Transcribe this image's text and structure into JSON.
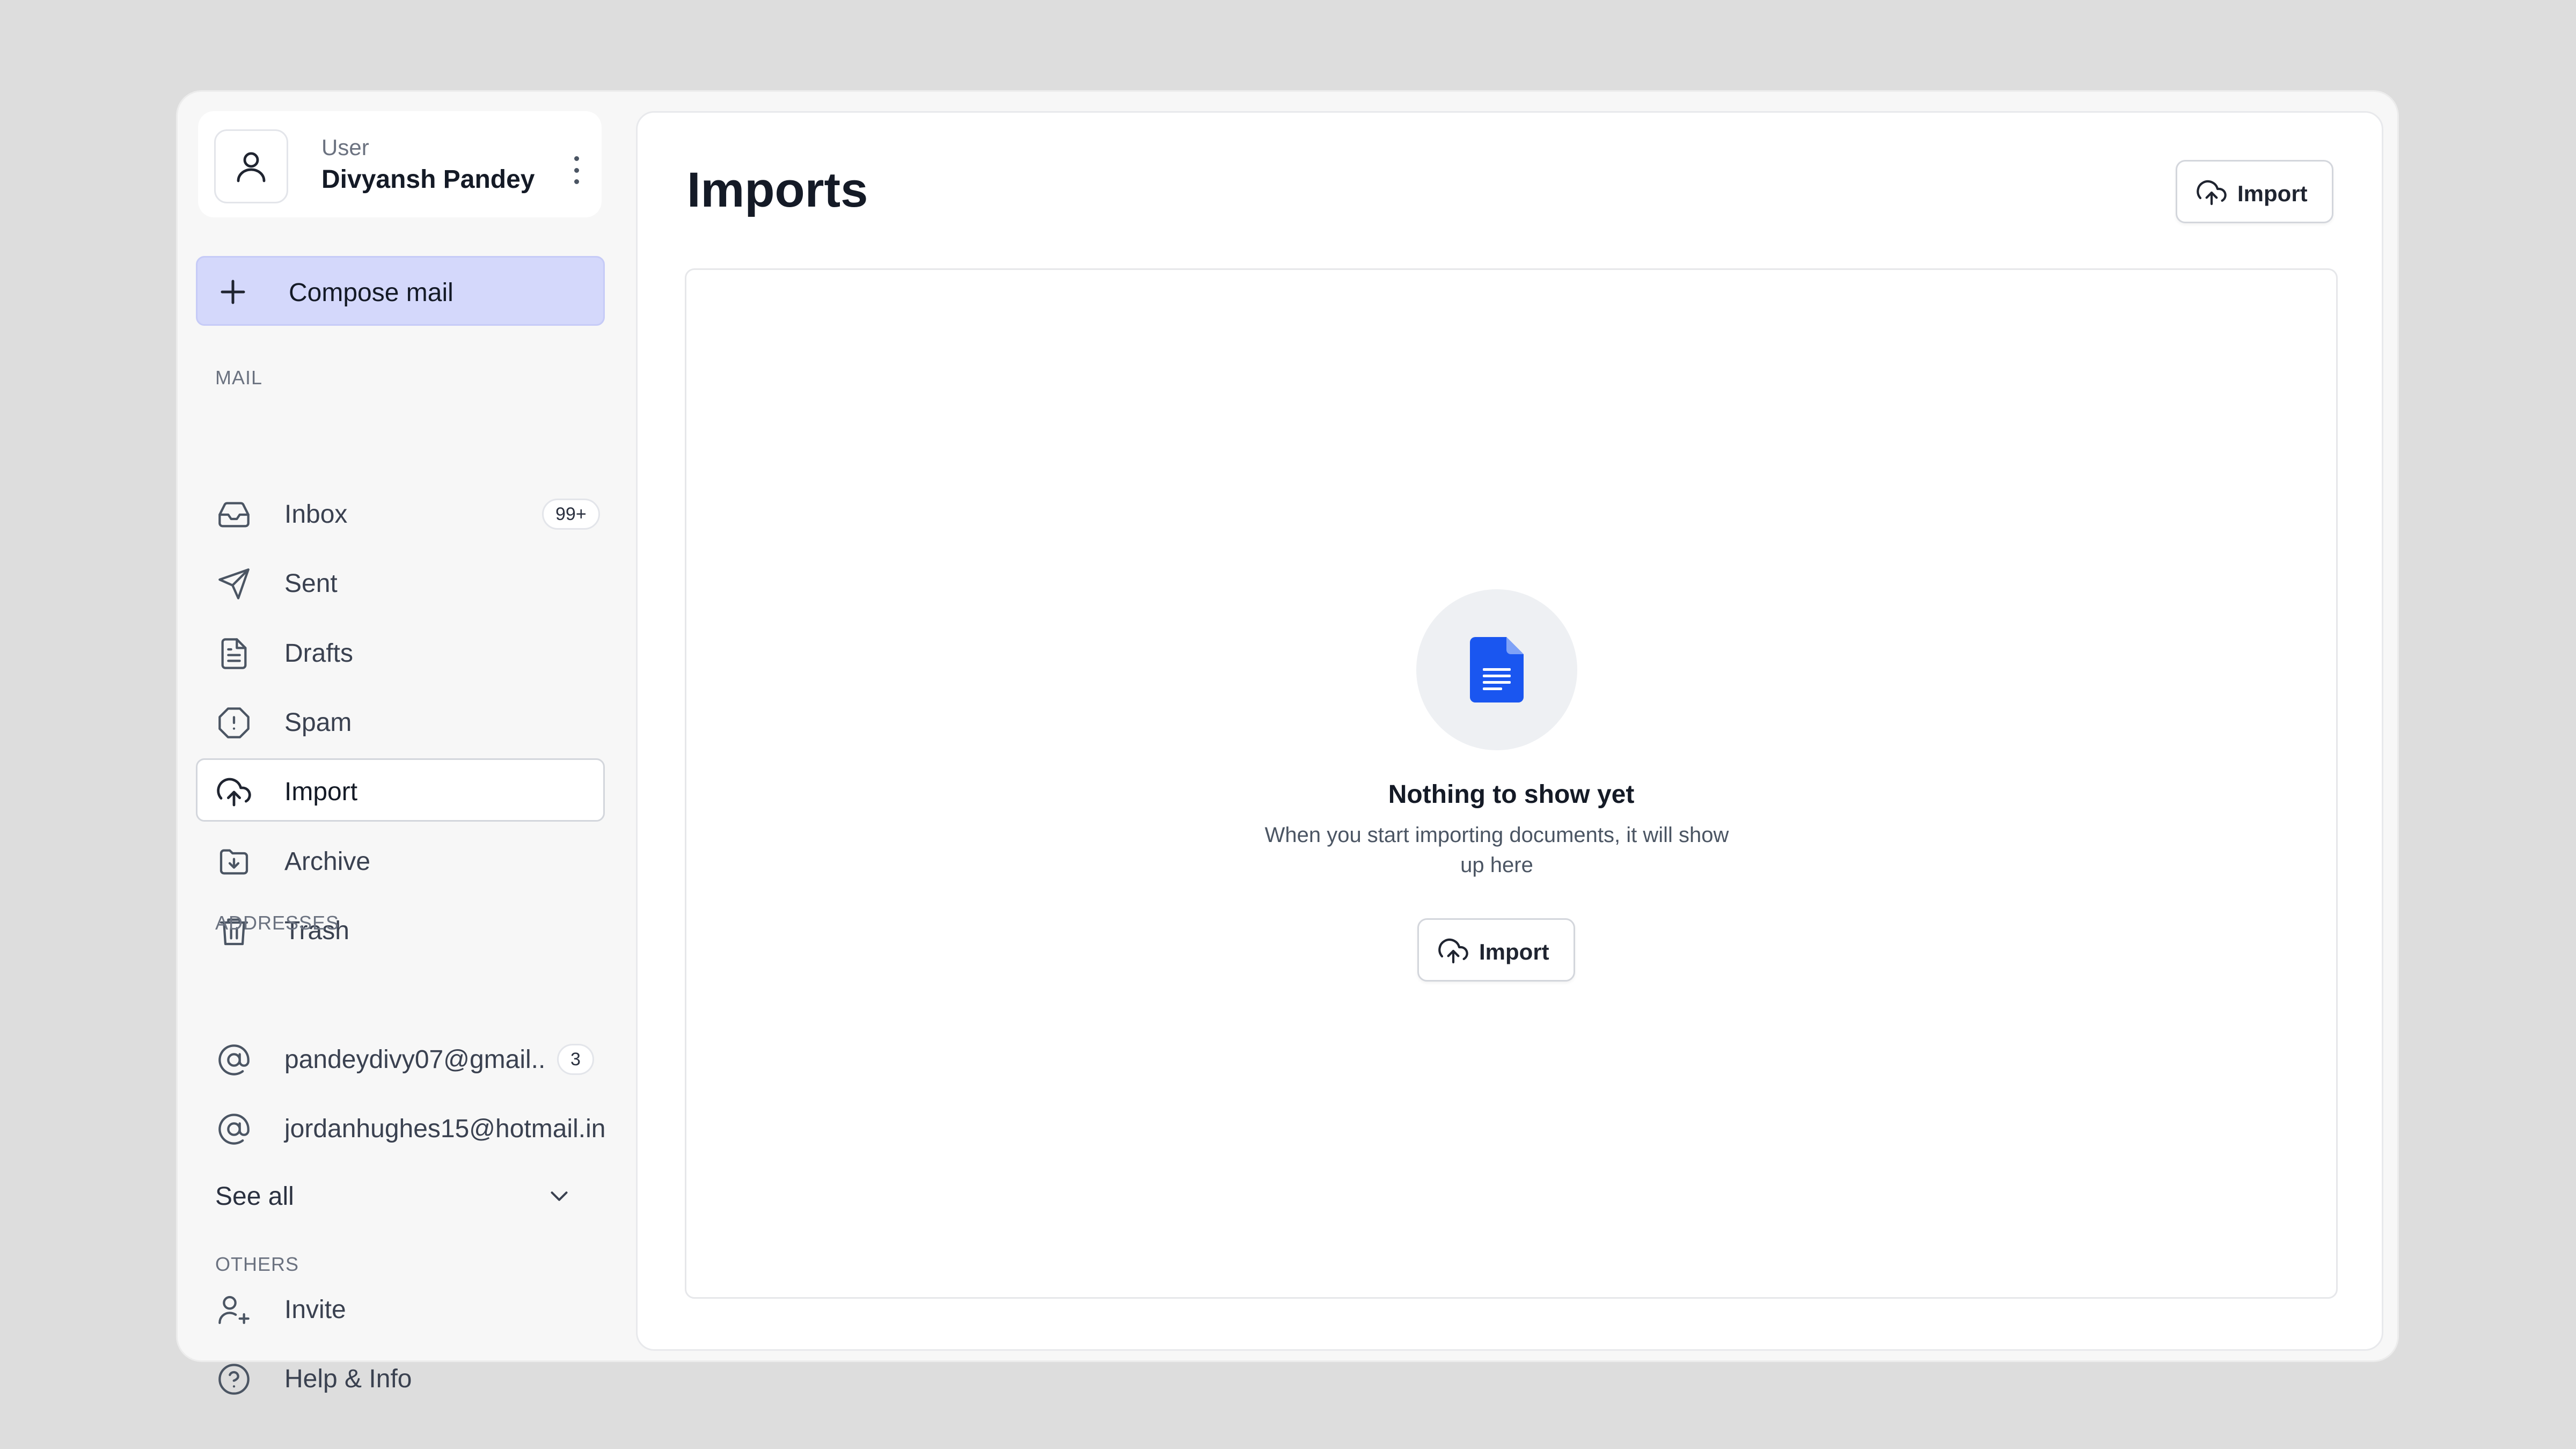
{
  "user": {
    "role": "User",
    "name": "Divyansh Pandey"
  },
  "sidebar": {
    "compose_label": "Compose mail",
    "mail_section": "MAIL",
    "mail_items": [
      {
        "label": "Inbox",
        "icon": "inbox-icon",
        "badge": "99+"
      },
      {
        "label": "Sent",
        "icon": "send-icon"
      },
      {
        "label": "Drafts",
        "icon": "file-text-icon"
      },
      {
        "label": "Spam",
        "icon": "alert-octagon-icon"
      },
      {
        "label": "Import",
        "icon": "upload-cloud-icon",
        "active": true
      },
      {
        "label": "Archive",
        "icon": "folder-download-icon"
      },
      {
        "label": "Trash",
        "icon": "trash-icon"
      }
    ],
    "addresses_section": "ADDRESSES",
    "addresses": [
      {
        "label": "pandeydivy07@gmail..",
        "icon": "at-sign-icon",
        "badge": "3"
      },
      {
        "label": "jordanhughes15@hotmail.in",
        "icon": "at-sign-icon"
      }
    ],
    "see_all_label": "See all",
    "others_section": "OTHERS",
    "others_items": [
      {
        "label": "Invite",
        "icon": "user-plus-icon"
      },
      {
        "label": "Help & Info",
        "icon": "help-circle-icon"
      }
    ]
  },
  "main": {
    "title": "Imports",
    "header_button_label": "Import",
    "empty_state": {
      "title": "Nothing to show yet",
      "description": "When you start importing documents, it will show up here",
      "button_label": "Import"
    }
  },
  "colors": {
    "accent_compose": "#d4d8fb",
    "doc_icon": "#1a56f0",
    "page_background": "#dddddd"
  }
}
